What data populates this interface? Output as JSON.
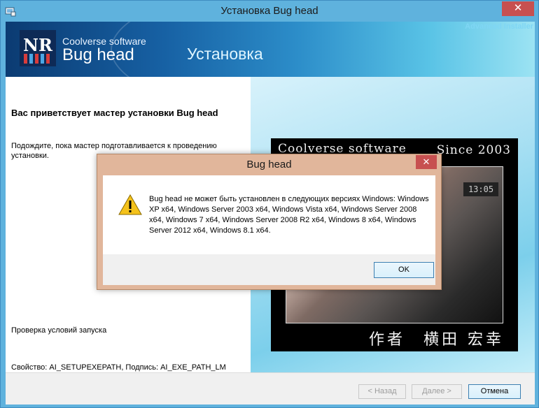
{
  "window": {
    "title": "Установка Bug head",
    "close_glyph": "✕"
  },
  "banner": {
    "logo_text": "NR",
    "company": "Coolverse software",
    "product": "Bug head",
    "stage": "Установка",
    "builder_brand": "Advanced Installer"
  },
  "content": {
    "heading": "Вас приветствует мастер установки Bug head",
    "description": "Подождите, пока мастер подготавливается к проведению установки.",
    "status": "Проверка условий запуска",
    "property_line": "Свойство: AI_SETUPEXEPATH, Подпись: AI_EXE_PATH_LM"
  },
  "splash": {
    "top_left": "Coolverse software",
    "top_right": "Since 2003",
    "bottom": "作者　横田 宏幸",
    "clock": "13:05"
  },
  "footer": {
    "back_label": "< Назад",
    "next_label": "Далее >",
    "cancel_label": "Отмена"
  },
  "dialog": {
    "title": "Bug head",
    "close_glyph": "✕",
    "icon": "warning-icon",
    "message": "Bug head не может быть установлен в следующих версиях Windows: Windows XP x64, Windows Server 2003 x64, Windows Vista x64, Windows Server 2008 x64, Windows 7 x64, Windows Server 2008 R2 x64, Windows 8 x64, Windows Server 2012 x64, Windows 8.1 x64.",
    "ok_label": "OK"
  },
  "colors": {
    "frame": "#5fb2dd",
    "dialog_frame": "#e1b69b",
    "close_red": "#c75050",
    "warning_yellow": "#f4c21b"
  }
}
